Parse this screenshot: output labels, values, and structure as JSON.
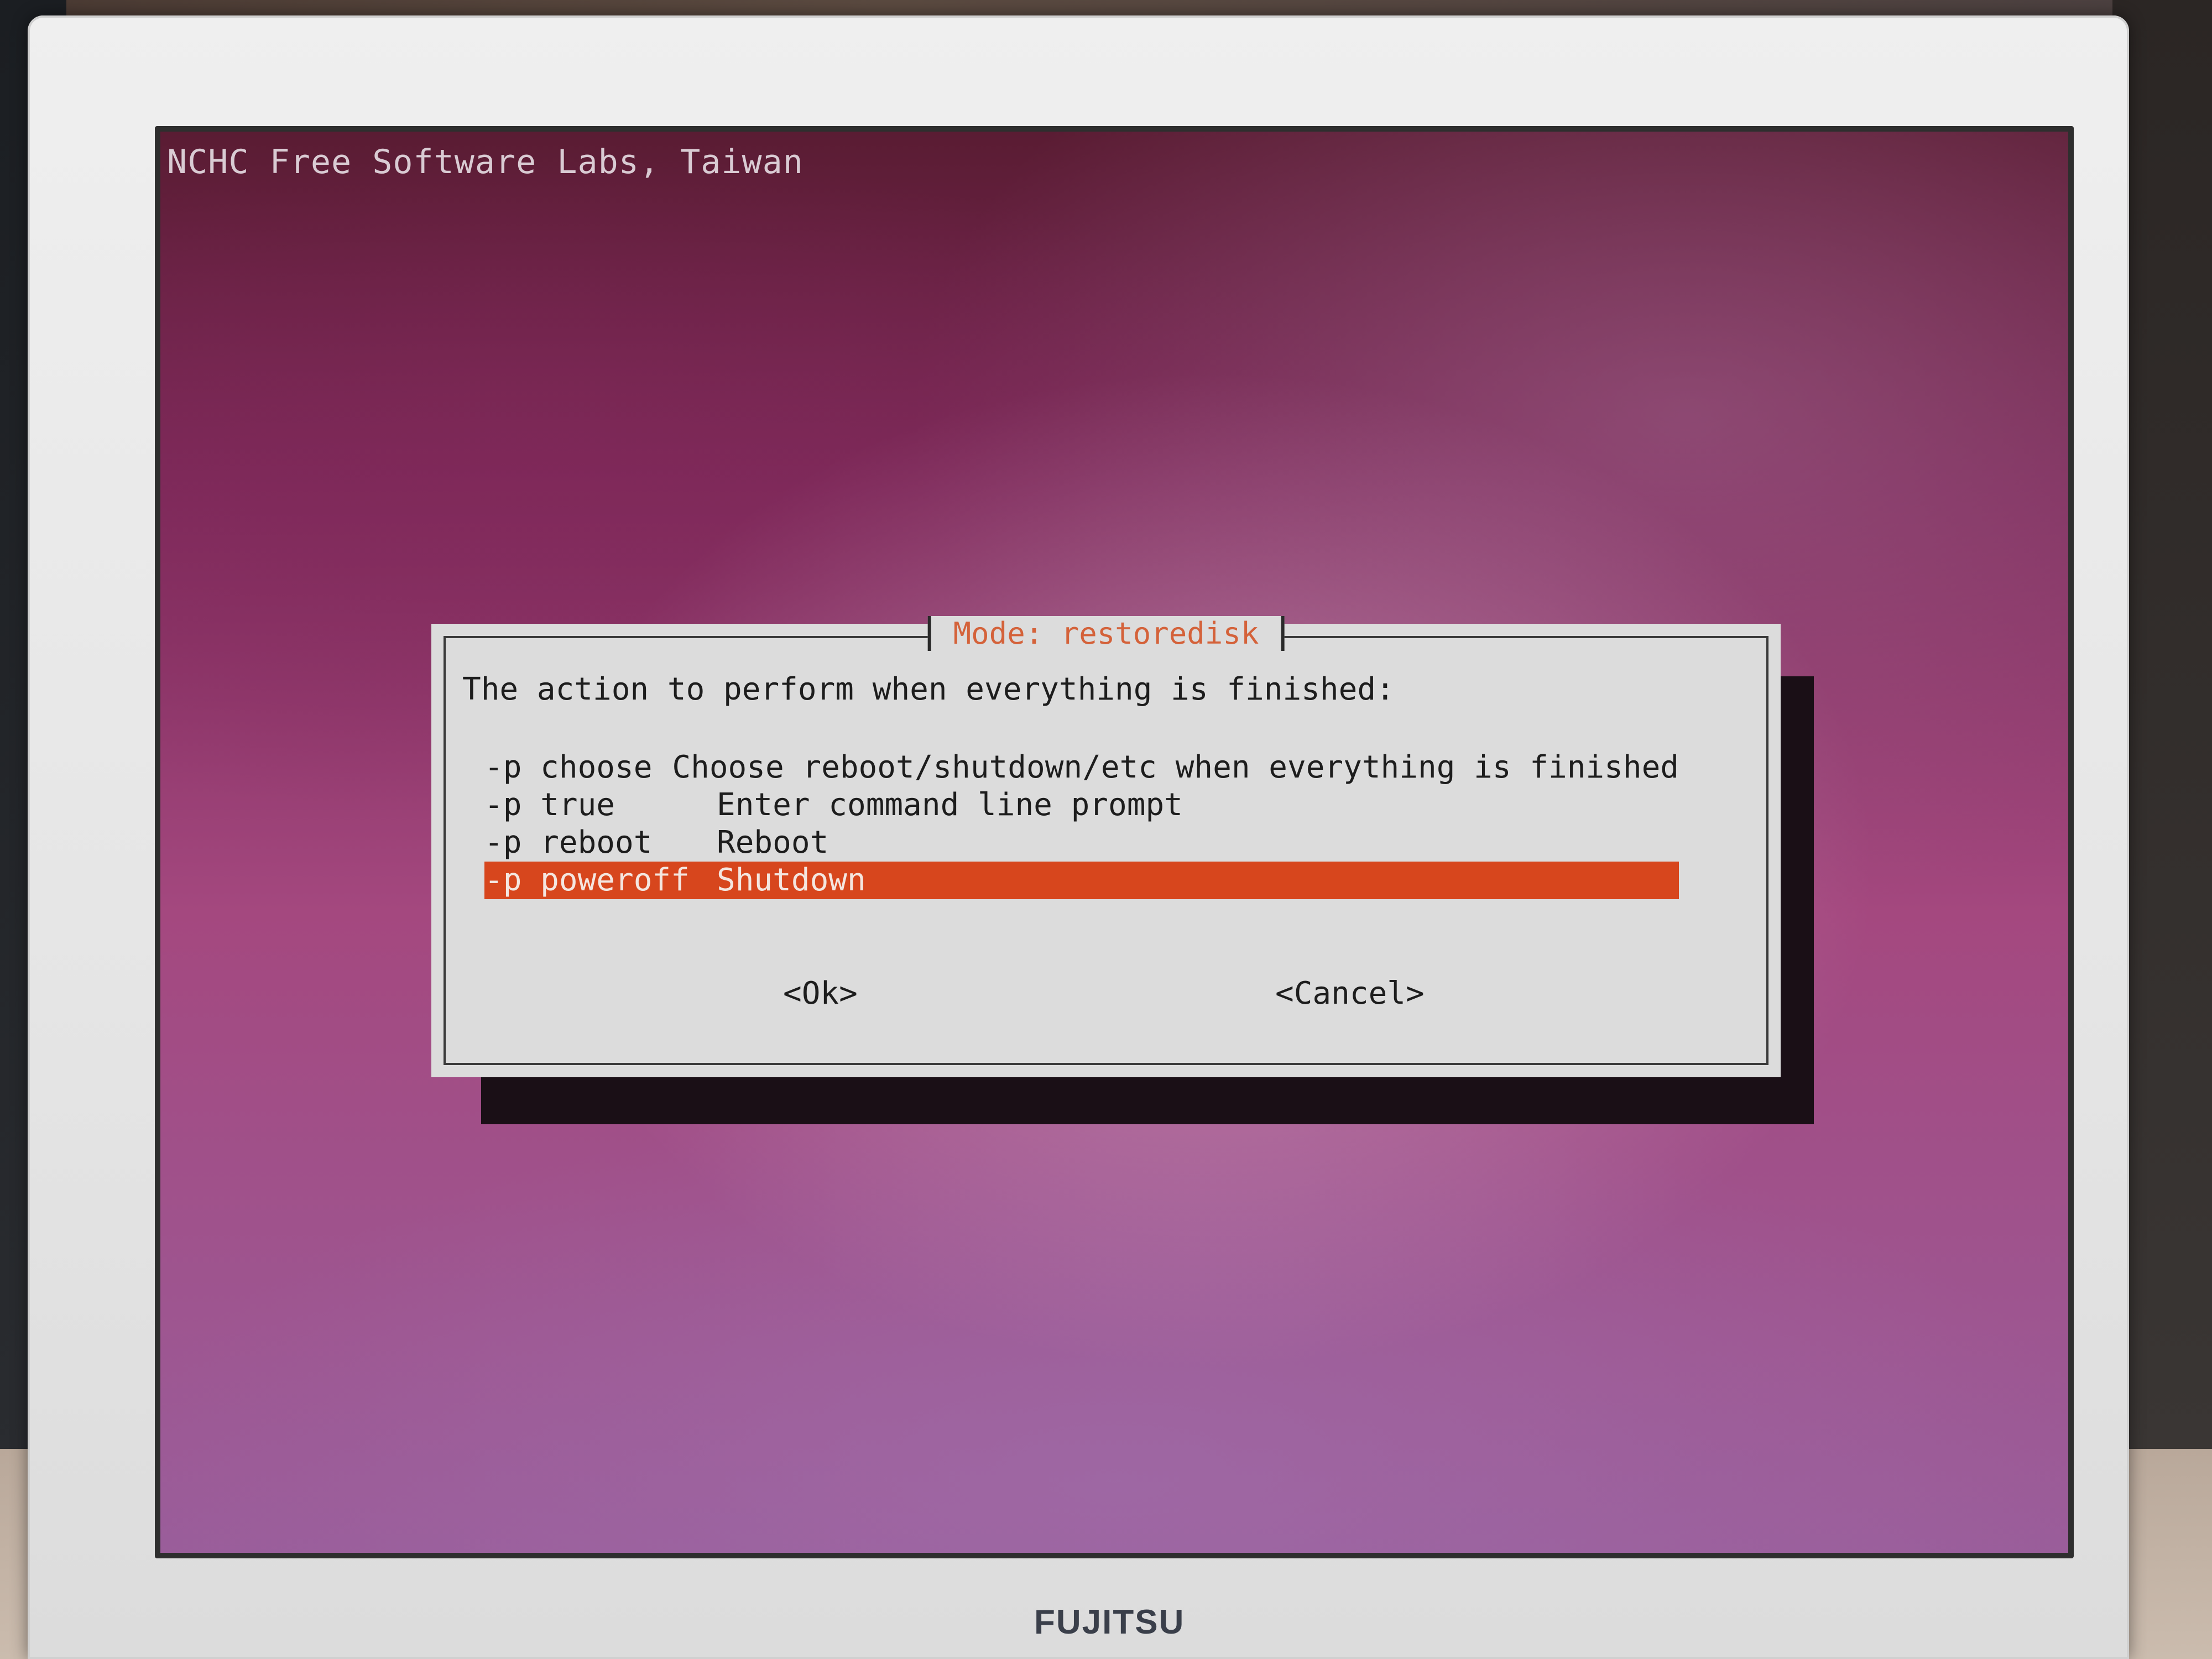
{
  "environment": {
    "monitor_brand": "FUJITSU"
  },
  "screen": {
    "top_title": "NCHC Free Software Labs, Taiwan",
    "colors": {
      "background_top": "#5a1c33",
      "background_bottom": "#9a5d9a",
      "selection": "#d7461d",
      "title_text": "#d4623a"
    }
  },
  "dialog": {
    "title": "Mode: restoredisk",
    "prompt": "The action to perform when everything is finished:",
    "items": [
      {
        "option": "-p choose",
        "description": "Choose reboot/shutdown/etc when everything is finished",
        "selected": false
      },
      {
        "option": "-p true",
        "description": "Enter command line prompt",
        "selected": false
      },
      {
        "option": "-p reboot",
        "description": "Reboot",
        "selected": false
      },
      {
        "option": "-p poweroff",
        "description": "Shutdown",
        "selected": true
      }
    ],
    "ok_label": "<Ok>",
    "cancel_label": "<Cancel>"
  }
}
